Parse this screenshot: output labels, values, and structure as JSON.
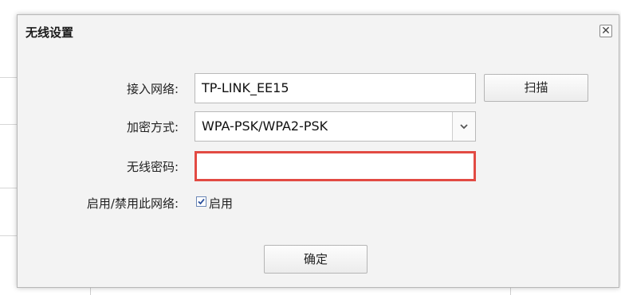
{
  "dialog": {
    "title": "无线设置",
    "close_glyph": "✕"
  },
  "form": {
    "network_label": "接入网络:",
    "network_value": "TP-LINK_EE15",
    "scan_label": "扫描",
    "encryption_label": "加密方式:",
    "encryption_value": "WPA-PSK/WPA2-PSK",
    "password_label": "无线密码:",
    "password_value": "",
    "enable_label": "启用/禁用此网络:",
    "enable_checkbox_label": "启用",
    "enable_checked": true
  },
  "footer": {
    "confirm_label": "确定"
  },
  "colors": {
    "highlight": "#e24a43",
    "checkmark": "#2a4f9c"
  }
}
